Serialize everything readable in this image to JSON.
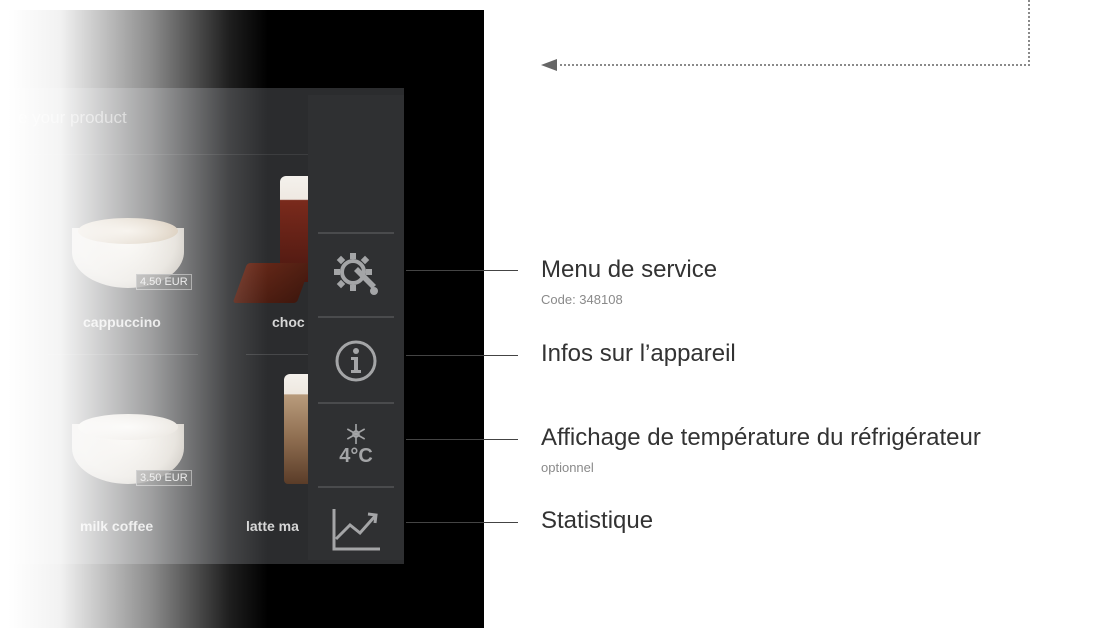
{
  "app": {
    "title": "e your product",
    "products": [
      {
        "label": "cappuccino",
        "price": "4.50 EUR"
      },
      {
        "label": "choc",
        "price": ""
      },
      {
        "label": "milk coffee",
        "price": "3.50 EUR"
      },
      {
        "label": "latte ma",
        "price": ""
      }
    ]
  },
  "side_panel": {
    "temperature": "4°C",
    "icons": [
      "service-gear-wrench-icon",
      "info-icon",
      "snowflake-icon",
      "statistics-chart-icon"
    ]
  },
  "callouts": {
    "service": {
      "title": "Menu de service",
      "sub": "Code: 348108"
    },
    "info": {
      "title": "Infos sur l’appareil"
    },
    "temperature": {
      "title": "Affichage de température du réfrigérateur",
      "sub": "optionnel"
    },
    "stats": {
      "title": "Statistique"
    }
  },
  "colors": {
    "screen_bg": "#000000",
    "app_bg": "#2b2c2e",
    "panel_bg": "#2f3032",
    "icon": "#a4a5a7",
    "callout_text": "#333333"
  }
}
